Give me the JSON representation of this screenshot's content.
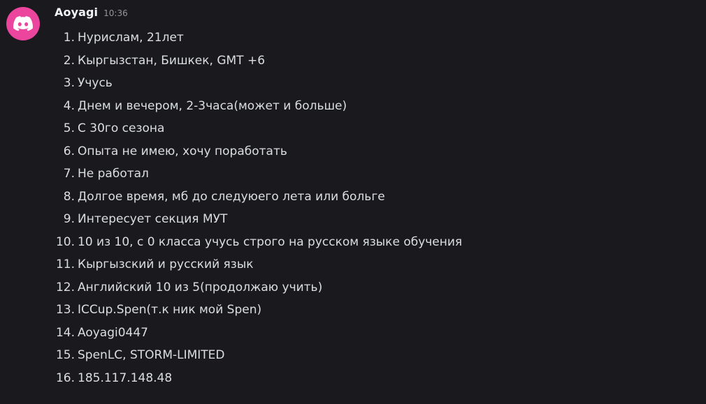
{
  "message": {
    "avatar_icon": "discord-logo-icon",
    "avatar_color": "#eb459e",
    "username": "Aoyagi",
    "timestamp": "10:36",
    "items": [
      {
        "num": "1.",
        "text": "Нурислам, 21лет"
      },
      {
        "num": "2.",
        "text": "Кыргызстан, Бишкек, GMT +6"
      },
      {
        "num": "3.",
        "text": "Учусь"
      },
      {
        "num": "4.",
        "text": "Днем и вечером, 2-3часа(может и больше)"
      },
      {
        "num": "5.",
        "text": "С 30го сезона"
      },
      {
        "num": "6.",
        "text": "Опыта не имею, хочу поработать"
      },
      {
        "num": "7.",
        "text": "Не работал"
      },
      {
        "num": "8.",
        "text": "Долгое время, мб до следуюего лета или больге"
      },
      {
        "num": "9.",
        "text": "Интересует секция МУТ"
      },
      {
        "num": "10.",
        "text": "10 из 10, с 0 класса учусь строго на русском языке обучения"
      },
      {
        "num": "11.",
        "text": "Кыргызский и русский язык"
      },
      {
        "num": "12.",
        "text": "Английский 10 из 5(продолжаю учить)"
      },
      {
        "num": "13.",
        "text": "ICCup.Spen(т.к ник мой Spen)"
      },
      {
        "num": "14.",
        "text": "Aoyagi0447"
      },
      {
        "num": "15.",
        "text": "SpenLC, STORM-LIMITED"
      },
      {
        "num": "16.",
        "text": "185.117.148.48"
      }
    ]
  }
}
